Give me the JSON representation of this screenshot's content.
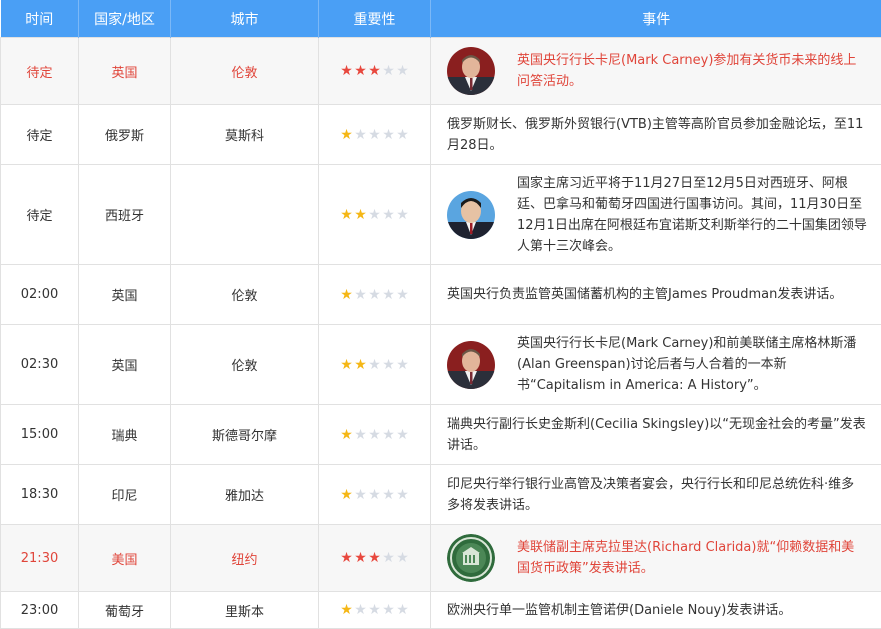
{
  "headers": {
    "time": "时间",
    "country": "国家/地区",
    "city": "城市",
    "importance": "重要性",
    "event": "事件"
  },
  "colors": {
    "header_bg": "#4a9ff5",
    "important_text": "#e0453a",
    "star_red": "#e8483e",
    "star_yellow": "#f5b716",
    "star_empty": "#d6dbe3"
  },
  "rows": [
    {
      "time": "待定",
      "country": "英国",
      "city": "伦敦",
      "stars": 3,
      "important": true,
      "avatar": "carney-portrait",
      "event": "英国央行行长卡尼(Mark Carney)参加有关货币未来的线上问答活动。"
    },
    {
      "time": "待定",
      "country": "俄罗斯",
      "city": "莫斯科",
      "stars": 1,
      "important": false,
      "avatar": "",
      "event": "俄罗斯财长、俄罗斯外贸银行(VTB)主管等高阶官员参加金融论坛，至11月28日。"
    },
    {
      "time": "待定",
      "country": "西班牙",
      "city": "",
      "stars": 2,
      "important": false,
      "avatar": "xi-portrait",
      "event": "国家主席习近平将于11月27日至12月5日对西班牙、阿根廷、巴拿马和葡萄牙四国进行国事访问。其间，11月30日至12月1日出席在阿根廷布宜诺斯艾利斯举行的二十国集团领导人第十三次峰会。"
    },
    {
      "time": "02:00",
      "country": "英国",
      "city": "伦敦",
      "stars": 1,
      "important": false,
      "avatar": "",
      "event": "英国央行负责监管英国储蓄机构的主管James Proudman发表讲话。"
    },
    {
      "time": "02:30",
      "country": "英国",
      "city": "伦敦",
      "stars": 2,
      "important": false,
      "avatar": "carney-portrait",
      "event": "英国央行行长卡尼(Mark Carney)和前美联储主席格林斯潘(Alan Greenspan)讨论后者与人合着的一本新书“Capitalism in America: A History”。"
    },
    {
      "time": "15:00",
      "country": "瑞典",
      "city": "斯德哥尔摩",
      "stars": 1,
      "important": false,
      "avatar": "",
      "event": "瑞典央行副行长史金斯利(Cecilia Skingsley)以“无现金社会的考量”发表讲话。"
    },
    {
      "time": "18:30",
      "country": "印尼",
      "city": "雅加达",
      "stars": 1,
      "important": false,
      "avatar": "",
      "event": "印尼央行举行银行业高管及决策者宴会，央行行长和印尼总统佐科·维多多将发表讲话。"
    },
    {
      "time": "21:30",
      "country": "美国",
      "city": "纽约",
      "stars": 3,
      "important": true,
      "avatar": "fed-seal",
      "event": "美联储副主席克拉里达(Richard Clarida)就“仰赖数据和美国货币政策”发表讲话。"
    },
    {
      "time": "23:00",
      "country": "葡萄牙",
      "city": "里斯本",
      "stars": 1,
      "important": false,
      "avatar": "",
      "event": "欧洲央行单一监管机制主管诺伊(Daniele Nouy)发表讲话。"
    }
  ]
}
